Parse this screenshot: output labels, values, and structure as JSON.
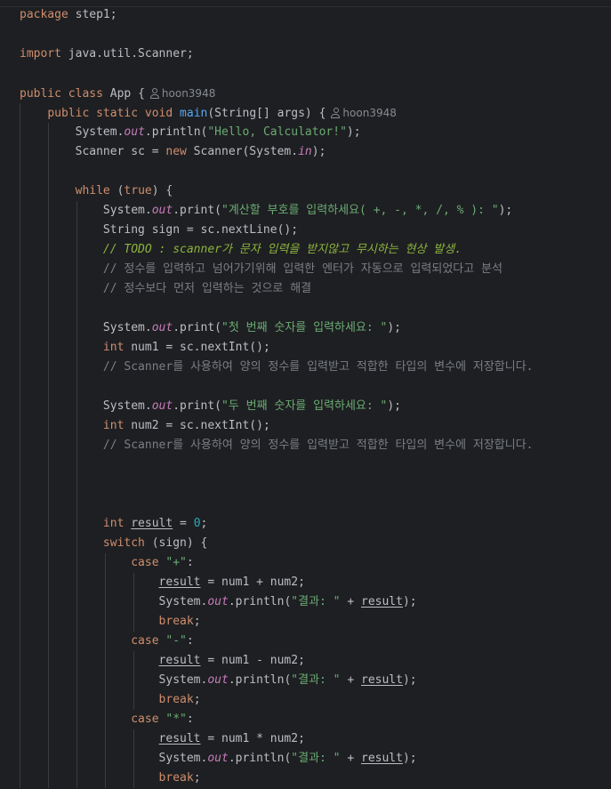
{
  "editor": {
    "author": "hoon3948"
  },
  "code": {
    "package_kw": "package",
    "package_name": " step1;",
    "import_kw": "import",
    "import_name": " java.util.Scanner;",
    "public": "public",
    "class": "class",
    "class_name": " App {",
    "static": "static",
    "void": "void",
    "main": "main",
    "main_sig": "(String[] args) {",
    "system": "System.",
    "out": "out",
    "println": ".println(",
    "print": ".print(",
    "hello": "\"Hello, Calculator!\"",
    "close_paren": ");",
    "scanner_decl": "Scanner sc = ",
    "new": "new",
    "scanner_ctor": " Scanner(System.",
    "in": "in",
    "while": "while",
    "while_cond": " (",
    "true": "true",
    "while_close": ") {",
    "prompt_sign": "\"계산할 부호를 입력하세요( +, -, *, /, % ): \"",
    "string_sign": "String sign = sc.nextLine();",
    "todo_comment": "// TODO : scanner가 문자 입력을 받지않고 무시하는 현상 발생.",
    "comment_1": "// 정수를 입력하고 넘어가기위해 입력한 엔터가 자동으로 입력되었다고 분석",
    "comment_2": "// 정수보다 먼저 입력하는 것으로 해결",
    "prompt_num1": "\"첫 번째 숫자를 입력하세요: \"",
    "int": "int",
    "num1_decl": " num1 = sc.nextInt();",
    "comment_scanner": "// Scanner를 사용하여 양의 정수를 입력받고 적합한 타입의 변수에 저장합니다.",
    "prompt_num2": "\"두 번째 숫자를 입력하세요: \"",
    "num2_decl": " num2 = sc.nextInt();",
    "result": "result",
    "eq_zero": " = ",
    "zero": "0",
    "semicolon": ";",
    "switch": "switch",
    "switch_cond": " (sign) {",
    "case": "case",
    "plus_str": "\"+\"",
    "minus_str": "\"-\"",
    "mul_str": "\"*\"",
    "colon": ":",
    "plus_expr": " = num1 + num2;",
    "minus_expr": " = num1 - num2;",
    "mul_expr": " = num1 * num2;",
    "result_str": "\"결과: \"",
    "concat": " + ",
    "break": "break",
    "space": " "
  }
}
